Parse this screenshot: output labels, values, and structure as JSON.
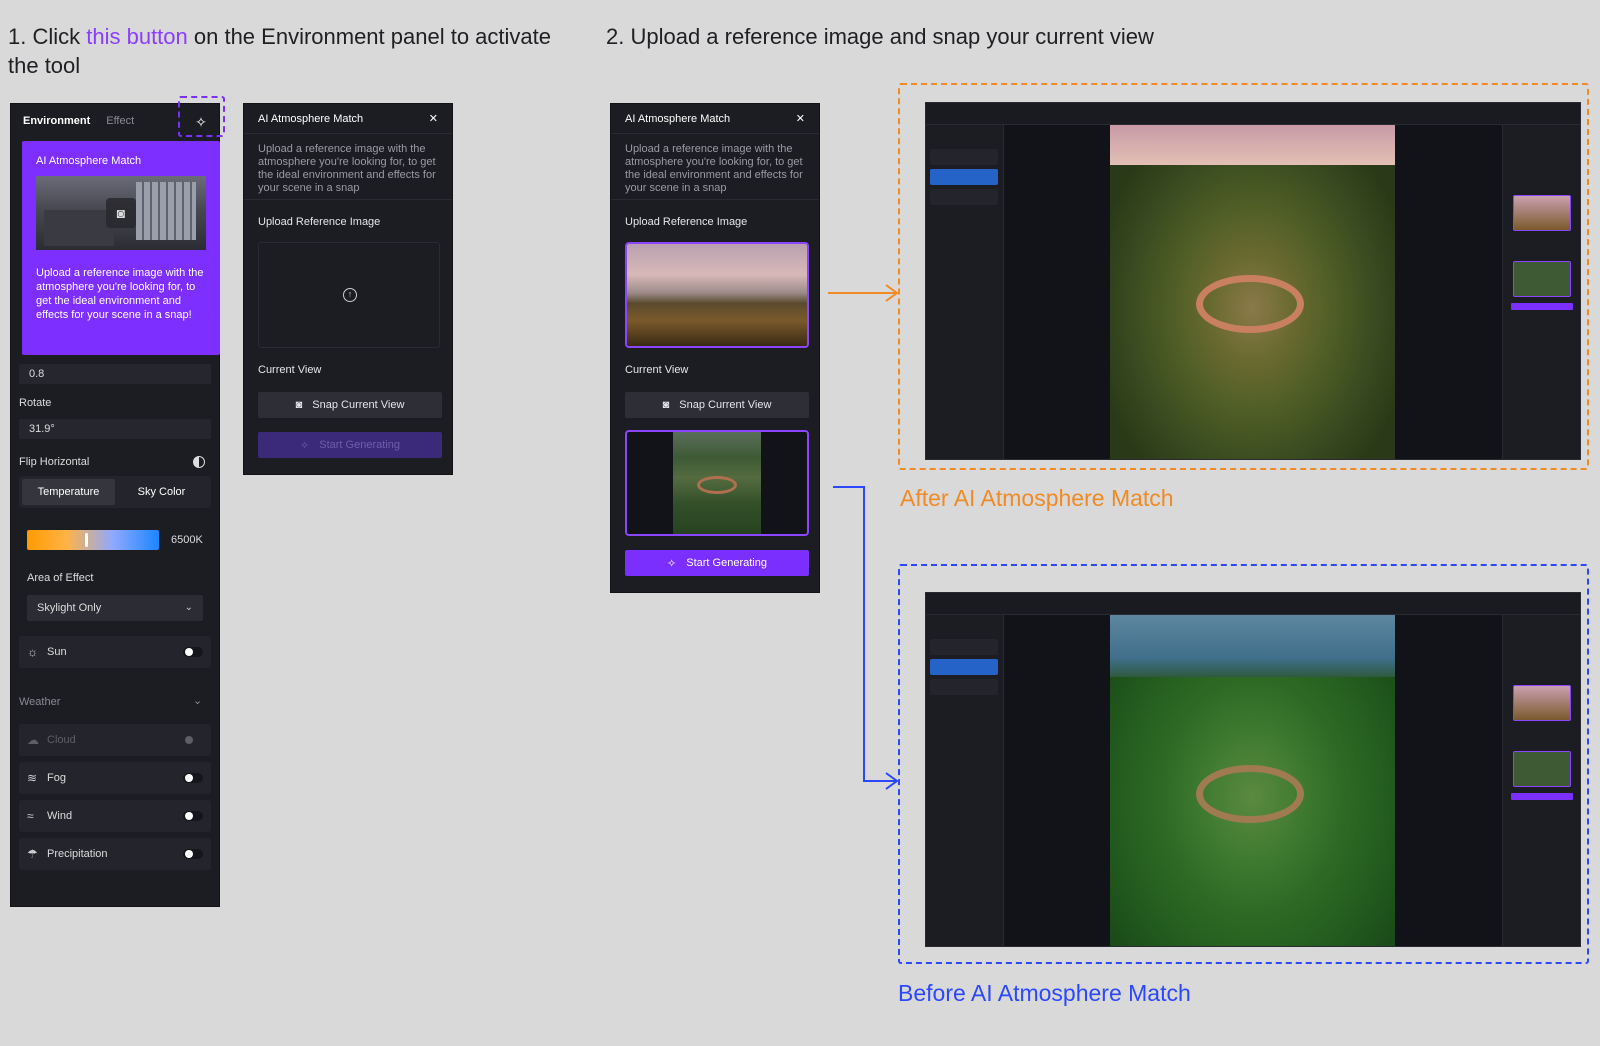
{
  "step1": {
    "prefix": "1. Click ",
    "link": "this button",
    "suffix": " on the Environment panel to activate the tool"
  },
  "step2": {
    "text": "2. Upload a reference image and snap your current view"
  },
  "env_panel": {
    "tab_environment": "Environment",
    "tab_effect": "Effect",
    "tooltip_title": "AI Atmosphere Match",
    "tooltip_text": "Upload a reference image with the atmosphere you're looking for, to get the ideal environment and effects for your scene in a snap!",
    "value_field": "0.8",
    "rotate_label": "Rotate",
    "rotate_value": "31.9°",
    "flip_label": "Flip Horizontal",
    "seg_temperature": "Temperature",
    "seg_sky_color": "Sky Color",
    "temp_value": "6500K",
    "area_label": "Area of Effect",
    "area_value": "Skylight Only",
    "sun_label": "Sun",
    "weather_label": "Weather",
    "cloud_label": "Cloud",
    "fog_label": "Fog",
    "wind_label": "Wind",
    "precip_label": "Precipitation"
  },
  "ai_panel_1": {
    "title": "AI Atmosphere Match",
    "desc": "Upload a reference image with the atmosphere you're looking for, to get the ideal environment and effects for your scene in a snap",
    "upload_label": "Upload Reference Image",
    "current_view_label": "Current View",
    "snap_button": "Snap Current View",
    "start_button": "Start Generating"
  },
  "ai_panel_2": {
    "title": "AI Atmosphere Match",
    "desc": "Upload a reference image with the atmosphere you're looking for, to get the ideal environment and effects for your scene in a snap",
    "upload_label": "Upload Reference Image",
    "current_view_label": "Current View",
    "snap_button": "Snap Current View",
    "start_button": "Start Generating"
  },
  "captions": {
    "after": "After AI Atmosphere Match",
    "before": "Before AI Atmosphere Match"
  },
  "colors": {
    "accent_purple": "#7a2fff",
    "orange": "#f08a24",
    "blue": "#2b47ff"
  }
}
